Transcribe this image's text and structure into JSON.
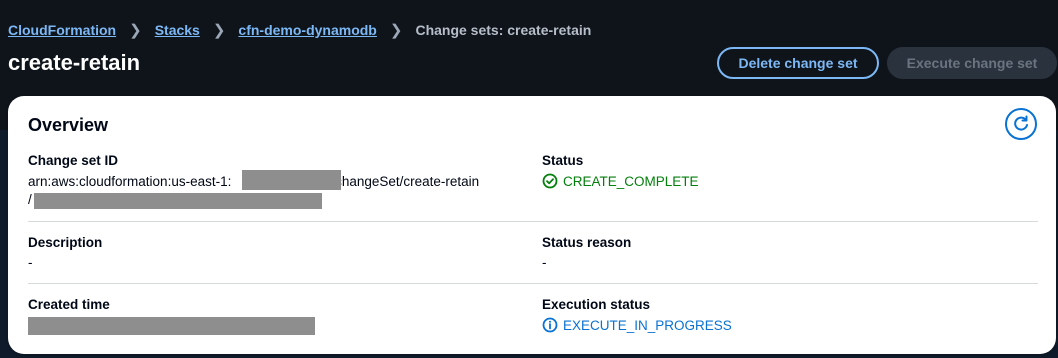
{
  "breadcrumb": {
    "items": [
      "CloudFormation",
      "Stacks",
      "cfn-demo-dynamodb"
    ],
    "current": "Change sets: create-retain"
  },
  "header": {
    "title": "create-retain",
    "delete_label": "Delete change set",
    "execute_label": "Execute change set"
  },
  "overview": {
    "title": "Overview",
    "change_set_id_label": "Change set ID",
    "change_set_id_prefix": "arn:aws:cloudformation:us-east-1:",
    "change_set_id_suffix": ":changeSet/create-retain",
    "change_set_id_line2": "/",
    "status_label": "Status",
    "status_value": "CREATE_COMPLETE",
    "description_label": "Description",
    "description_value": "-",
    "status_reason_label": "Status reason",
    "status_reason_value": "-",
    "created_time_label": "Created time",
    "execution_status_label": "Execution status",
    "execution_status_value": "EXECUTE_IN_PROGRESS"
  },
  "colors": {
    "link": "#7cb8f5",
    "success": "#037f0c",
    "info": "#0972d3",
    "header_bg": "#0f141a"
  },
  "icons": {
    "status": "check-circle-icon",
    "execution": "info-circle-icon",
    "refresh": "refresh-icon"
  }
}
